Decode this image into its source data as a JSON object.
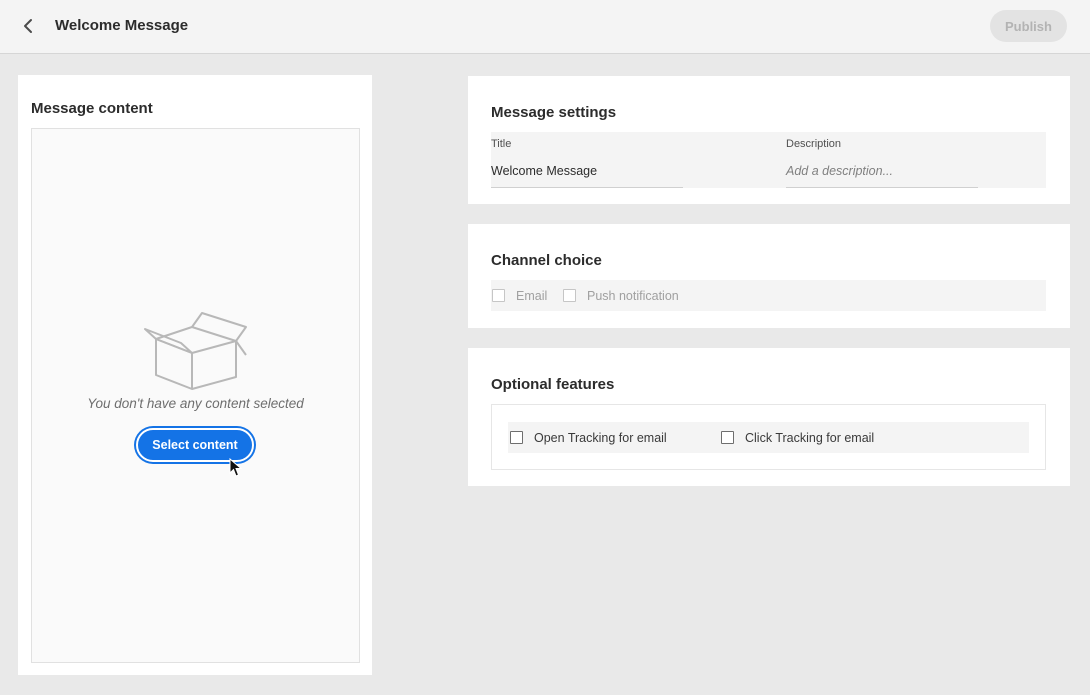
{
  "header": {
    "title": "Welcome Message",
    "publish_label": "Publish"
  },
  "message_content": {
    "title": "Message content",
    "empty_text": "You don't have any content selected",
    "select_button_label": "Select content"
  },
  "message_settings": {
    "title": "Message settings",
    "title_field": {
      "label": "Title",
      "value": "Welcome Message"
    },
    "description_field": {
      "label": "Description",
      "placeholder": "Add a description..."
    }
  },
  "channel_choice": {
    "title": "Channel choice",
    "options": [
      {
        "label": "Email",
        "checked": false,
        "disabled": true
      },
      {
        "label": "Push notification",
        "checked": false,
        "disabled": true
      }
    ]
  },
  "optional_features": {
    "title": "Optional features",
    "options": [
      {
        "label": "Open Tracking for email",
        "checked": false
      },
      {
        "label": "Click Tracking for email",
        "checked": false
      }
    ]
  },
  "colors": {
    "accent": "#1473e6",
    "background": "#e9e9e9",
    "card": "#ffffff",
    "disabled_text": "#b3b3b3"
  },
  "icons": {
    "back": "chevron-left-icon",
    "empty": "open-box-icon",
    "pointer": "mouse-cursor-icon"
  }
}
